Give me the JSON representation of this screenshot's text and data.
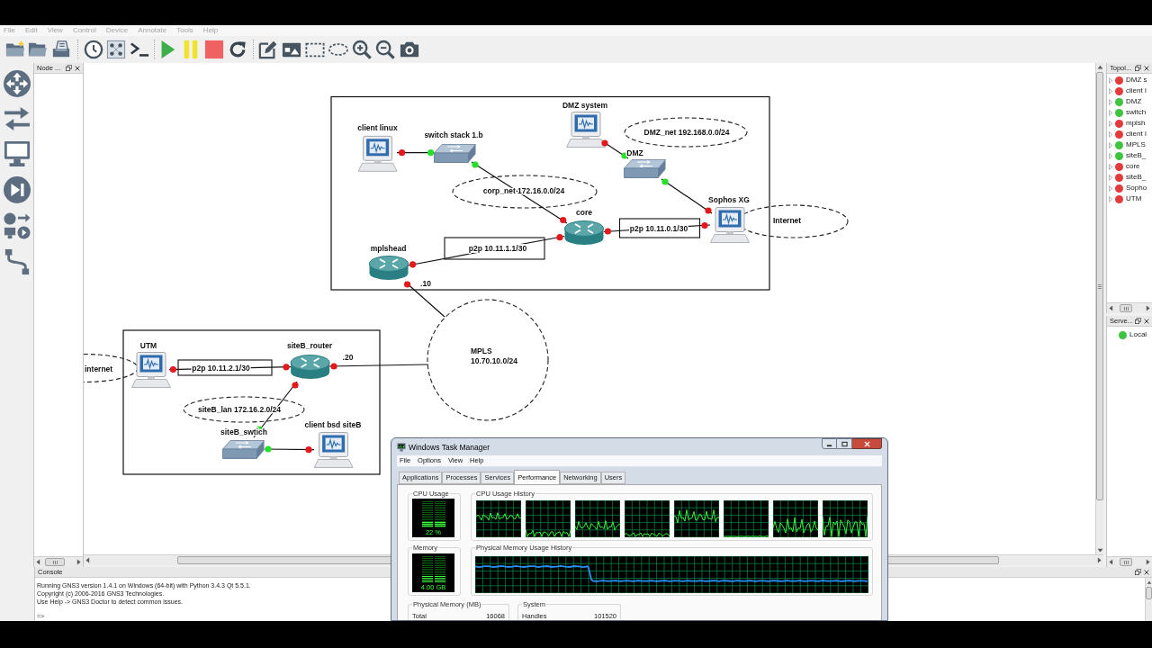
{
  "menu": [
    "File",
    "Edit",
    "View",
    "Control",
    "Device",
    "Annotate",
    "Tools",
    "Help"
  ],
  "node_panel": {
    "title": "Node ..."
  },
  "canvas": {
    "nodes": [
      {
        "label": "client linux",
        "kind": "host"
      },
      {
        "label": "switch stack 1.b",
        "kind": "switch"
      },
      {
        "label": "DMZ system",
        "kind": "host"
      },
      {
        "label": "DMZ",
        "kind": "switch"
      },
      {
        "label": "Sophos XG",
        "kind": "host"
      },
      {
        "label": "core",
        "kind": "router"
      },
      {
        "label": "mplshead",
        "kind": "router"
      },
      {
        "label": "UTM",
        "kind": "host"
      },
      {
        "label": "siteB_router",
        "kind": "router"
      },
      {
        "label": "siteB_swtich",
        "kind": "switch"
      },
      {
        "label": "client bsd siteB",
        "kind": "host"
      }
    ],
    "links": [
      {
        "a_up": false,
        "b_up": true
      },
      {
        "a_up": true,
        "b_up": false
      },
      {
        "a_up": false,
        "b_up": true
      },
      {
        "a_up": true,
        "b_up": false
      },
      {
        "a_up": false,
        "b_up": false
      },
      {
        "a_up": false,
        "b_up": false
      },
      {
        "a_up": false
      },
      {
        "a_up": false,
        "b_up": false
      },
      {
        "a_up": false
      },
      {
        "a_up": false,
        "b_up": true
      },
      {
        "a_up": true,
        "b_up": false
      }
    ],
    "notes": [
      {
        "kind": "ellipse",
        "lines": [
          "DMZ_net 192.168.0.0/24"
        ]
      },
      {
        "kind": "ellipse",
        "lines": [
          "corp_net 172.16.0.0/24"
        ]
      },
      {
        "kind": "ellipse",
        "lines": [
          "Internet"
        ]
      },
      {
        "kind": "frame",
        "lines": [
          "p2p 10.11.0.1/30"
        ]
      },
      {
        "kind": "frame",
        "lines": [
          "p2p 10.11.1.1/30"
        ]
      },
      {
        "kind": "text",
        "lines": [
          ".10"
        ]
      },
      {
        "kind": "ellipse",
        "lines": [
          "internet"
        ]
      },
      {
        "kind": "frame",
        "lines": [
          "p2p 10.11.2.1/30"
        ]
      },
      {
        "kind": "text",
        "lines": [
          ".20"
        ]
      },
      {
        "kind": "circle",
        "lines": [
          "MPLS",
          "10.70.10.0/24"
        ]
      },
      {
        "kind": "ellipse",
        "lines": [
          "siteB_lan 172.16.2.0/24"
        ]
      }
    ]
  },
  "topology": {
    "title": "Topol...",
    "items": [
      {
        "label": "DMZ s",
        "running": false
      },
      {
        "label": "client l",
        "running": false
      },
      {
        "label": "DMZ",
        "running": true
      },
      {
        "label": "switch",
        "running": true
      },
      {
        "label": "mplsh",
        "running": false
      },
      {
        "label": "client l",
        "running": false
      },
      {
        "label": "MPLS",
        "running": true
      },
      {
        "label": "siteB_",
        "running": true
      },
      {
        "label": "core",
        "running": false
      },
      {
        "label": "siteB_",
        "running": false
      },
      {
        "label": "Sopho",
        "running": false
      },
      {
        "label": "UTM",
        "running": false
      }
    ]
  },
  "servers": {
    "title": "Serve...",
    "items": [
      {
        "label": "Local",
        "running": true
      }
    ]
  },
  "console": {
    "title": "Console",
    "lines": [
      "Running GNS3 version 1.4.1 on Windows (64-bit) with Python 3.4.3 Qt 5.5.1.",
      "Copyright (c) 2006-2016 GNS3 Technologies.",
      "Use Help -> GNS3 Doctor to detect common issues."
    ],
    "prompt": "=>"
  },
  "task_manager": {
    "title": "Windows Task Manager",
    "menu": [
      "File",
      "Options",
      "View",
      "Help"
    ],
    "tabs": [
      {
        "label": "Applications",
        "selected": false
      },
      {
        "label": "Processes",
        "selected": false
      },
      {
        "label": "Services",
        "selected": false
      },
      {
        "label": "Performance",
        "selected": true
      },
      {
        "label": "Networking",
        "selected": false
      },
      {
        "label": "Users",
        "selected": false
      }
    ],
    "cpu_usage": {
      "title": "CPU Usage",
      "reading": "22 %",
      "level": 0.22
    },
    "cpu_history": {
      "title": "CPU Usage History"
    },
    "memory": {
      "title": "Memory",
      "reading": "4.00 GB",
      "level": 0.25
    },
    "memory_history": {
      "title": "Physical Memory Usage History"
    },
    "physical_memory": {
      "title": "Physical Memory (MB)",
      "rows": [
        {
          "label": "Total",
          "value": "16068"
        }
      ]
    },
    "system": {
      "title": "System",
      "rows": [
        {
          "label": "Handles",
          "value": "101520"
        }
      ]
    }
  }
}
